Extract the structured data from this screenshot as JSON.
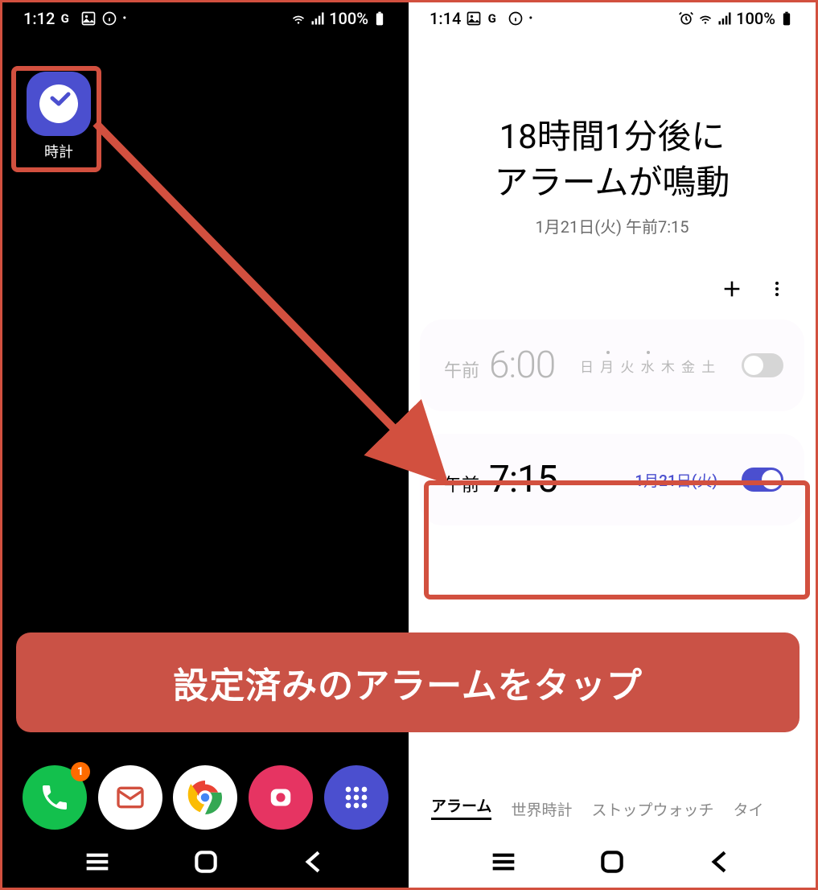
{
  "left": {
    "status": {
      "time": "1:12",
      "icons": [
        "G",
        "image",
        "info",
        "more"
      ],
      "battery": "100%"
    },
    "app": {
      "label": "時計"
    },
    "dock": {
      "phone_badge": "1"
    }
  },
  "right": {
    "status": {
      "time": "1:14",
      "icons": [
        "image",
        "G",
        "info",
        "more"
      ],
      "battery": "100%"
    },
    "header": {
      "line1": "18時間1分後に",
      "line2": "アラームが鳴動",
      "sub": "1月21日(火) 午前7:15"
    },
    "alarms": [
      {
        "ampm": "午前",
        "time": "6:00",
        "days": "日 月 火 水 木 金 土",
        "on": false
      },
      {
        "ampm": "午前",
        "time": "7:15",
        "date": "1月21日(火)",
        "on": true
      }
    ],
    "tabs": [
      "アラーム",
      "世界時計",
      "ストップウォッチ",
      "タイ"
    ]
  },
  "callout": "設定済みのアラームをタップ",
  "colors": {
    "accent": "#4b4fcf",
    "highlight": "#d2503f"
  }
}
